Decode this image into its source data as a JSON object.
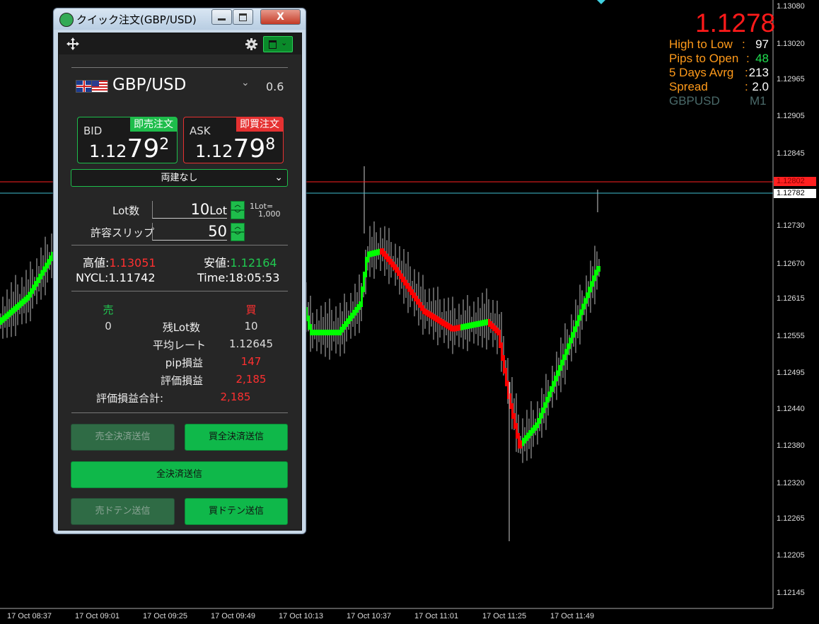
{
  "chart": {
    "symbol_label": "GBPUSD",
    "timeframe": "M1",
    "current_price": "1.1278",
    "info": [
      {
        "label": "High to Low",
        "sep": ":",
        "value": "97"
      },
      {
        "label": "Pips to Open",
        "sep": ":",
        "value": "48"
      },
      {
        "label": "5 Days Avrg",
        "sep": ":",
        "value": "213"
      },
      {
        "label": "Spread",
        "sep": ":",
        "value": "2.0"
      }
    ],
    "price_axis": [
      "1.13080",
      "1.13020",
      "1.12965",
      "1.12905",
      "1.12845",
      "1.12730",
      "1.12670",
      "1.12615",
      "1.12555",
      "1.12495",
      "1.12440",
      "1.12380",
      "1.12320",
      "1.12265",
      "1.12205",
      "1.12145"
    ],
    "price_tags": {
      "ask": "1.12802",
      "bid": "1.12782"
    },
    "time_axis": [
      "17 Oct 08:37",
      "17 Oct 09:01",
      "17 Oct 09:25",
      "17 Oct 09:49",
      "17 Oct 10:13",
      "17 Oct 10:37",
      "17 Oct 11:01",
      "17 Oct 11:25",
      "17 Oct 11:49"
    ],
    "colors": {
      "up": "#00ff00",
      "down": "#ff0000",
      "ask_line": "#ff2020",
      "bid_line": "#40c0d0",
      "orange": "#ff9a1a"
    }
  },
  "window": {
    "title": "クイック注文(GBP/USD)",
    "buttons": {
      "minimize": "—",
      "maximize": "□",
      "close": "X"
    }
  },
  "order": {
    "symbol": "GBP/USD",
    "spread": "0.6",
    "bid": {
      "label": "BID",
      "badge": "即売注文",
      "small": "1.12",
      "big": "79",
      "sup": "2"
    },
    "ask": {
      "label": "ASK",
      "badge": "即買注文",
      "small": "1.12",
      "big": "79",
      "sup": "8"
    },
    "hedge_select": "両建なし",
    "lot_label": "Lot数",
    "lot_value": "10",
    "lot_unit": "Lot",
    "lot_note_1": "1Lot=",
    "lot_note_2": "1,000",
    "slip_label": "許容スリップ",
    "slip_value": "50",
    "high_label": "高値:",
    "high_value": "1.13051",
    "low_label": "安値:",
    "low_value": "1.12164",
    "nycl_label": "NYCL:",
    "nycl_value": "1.11742",
    "time_label": "Time:",
    "time_value": "18:05:53"
  },
  "position": {
    "sell_header": "売",
    "buy_header": "買",
    "rows": [
      {
        "label": "残Lot数",
        "sell": "0",
        "buy": "10"
      },
      {
        "label": "平均レート",
        "sell": "",
        "buy": "1.12645"
      },
      {
        "label": "pip損益",
        "sell": "",
        "buy": "147"
      },
      {
        "label": "評価損益",
        "sell": "",
        "buy": "2,185"
      }
    ],
    "total_label": "評価損益合計:",
    "total_value": "2,185"
  },
  "actions": {
    "sell_close_all": "売全決済送信",
    "buy_close_all": "買全決済送信",
    "close_all": "全決済送信",
    "sell_doten": "売ドテン送信",
    "buy_doten": "買ドテン送信"
  }
}
